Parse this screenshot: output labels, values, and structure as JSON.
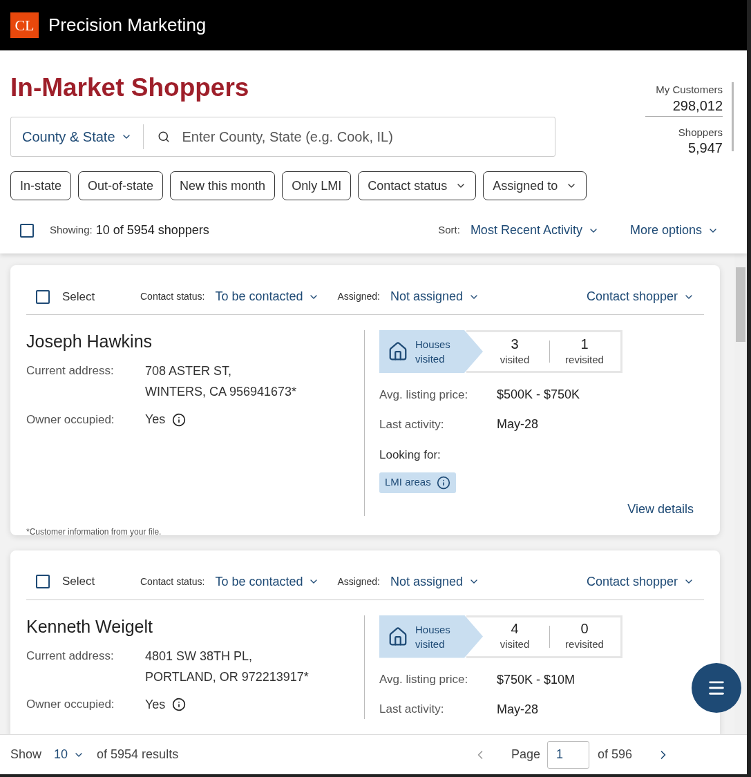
{
  "header": {
    "logo": "CL",
    "title": "Precision Marketing"
  },
  "page_title": "In-Market Shoppers",
  "stats": [
    {
      "label": "My Customers",
      "value": "298,012"
    },
    {
      "label": "Shoppers",
      "value": "5,947"
    }
  ],
  "search": {
    "scope": "County & State",
    "placeholder": "Enter County, State (e.g. Cook, IL)"
  },
  "filters": [
    {
      "label": "In-state",
      "kind": "toggle"
    },
    {
      "label": "Out-of-state",
      "kind": "toggle"
    },
    {
      "label": "New this month",
      "kind": "toggle"
    },
    {
      "label": "Only LMI",
      "kind": "toggle"
    },
    {
      "label": "Contact status",
      "kind": "dropdown"
    },
    {
      "label": "Assigned to",
      "kind": "dropdown"
    }
  ],
  "list_header": {
    "checked": false,
    "showing_label": "Showing:",
    "showing_count": "10 of 5954 shoppers",
    "sort_label": "Sort:",
    "sort_value": "Most Recent Activity",
    "more_options": "More options"
  },
  "shoppers": [
    {
      "checked": false,
      "select_label": "Select",
      "contact_status_label": "Contact status:",
      "contact_status": "To be contacted",
      "assigned_label": "Assigned:",
      "assigned": "Not assigned",
      "contact_action": "Contact shopper",
      "name": "Joseph Hawkins",
      "address_label": "Current address:",
      "address_lines": [
        "708 ASTER ST,",
        "WINTERS, CA 956941673*"
      ],
      "owner_label": "Owner occupied:",
      "owner_value": "Yes",
      "houses_label": "Houses visited",
      "visited_count": "3",
      "visited_label": "visited",
      "revisited_count": "1",
      "revisited_label": "revisited",
      "price_label": "Avg. listing price:",
      "price": "$500K - $750K",
      "activity_label": "Last activity:",
      "activity": "May-28",
      "looking_label": "Looking for:",
      "looking_tags": [
        "LMI areas"
      ],
      "footnote": "*Customer information from your file.",
      "details_link": "View details"
    },
    {
      "checked": false,
      "select_label": "Select",
      "contact_status_label": "Contact status:",
      "contact_status": "To be contacted",
      "assigned_label": "Assigned:",
      "assigned": "Not assigned",
      "contact_action": "Contact shopper",
      "name": "Kenneth Weigelt",
      "address_label": "Current address:",
      "address_lines": [
        "4801 SW 38TH PL,",
        "PORTLAND, OR 972213917*"
      ],
      "owner_label": "Owner occupied:",
      "owner_value": "Yes",
      "houses_label": "Houses visited",
      "visited_count": "4",
      "visited_label": "visited",
      "revisited_count": "0",
      "revisited_label": "revisited",
      "price_label": "Avg. listing price:",
      "price": "$750K - $10M",
      "activity_label": "Last activity:",
      "activity": "May-28"
    }
  ],
  "footer": {
    "show_label": "Show",
    "page_size": "10",
    "results": "of 5954 results",
    "page_label": "Page",
    "page": "1",
    "total_pages": "of 596"
  }
}
